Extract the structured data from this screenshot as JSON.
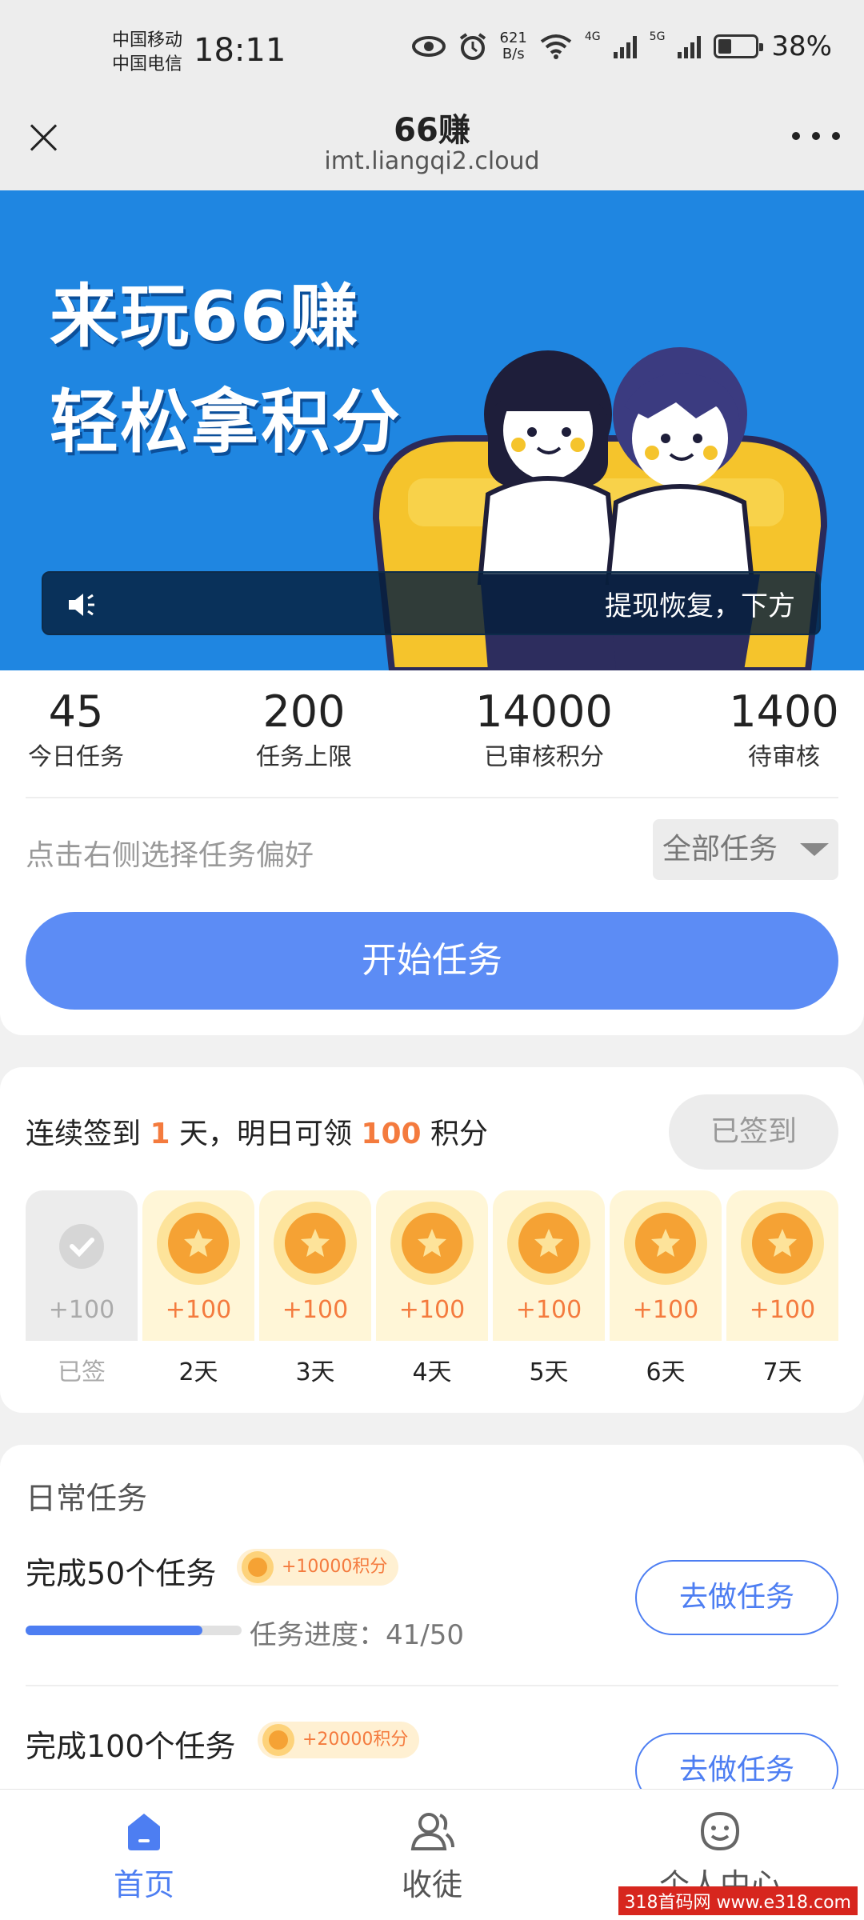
{
  "status_bar": {
    "carrier_1": "中国移动",
    "carrier_2": "中国电信",
    "time": "18:11",
    "net_speed_value": "621",
    "net_speed_unit": "B/s",
    "net_1": "4G",
    "net_2": "5G",
    "battery": "38%"
  },
  "nav": {
    "title": "66赚",
    "url": "imt.liangqi2.cloud"
  },
  "banner": {
    "line_1": "来玩66赚",
    "line_2": "轻松拿积分",
    "notice": "提现恢复，下方"
  },
  "stats": [
    {
      "value": "45",
      "label": "今日任务"
    },
    {
      "value": "200",
      "label": "任务上限"
    },
    {
      "value": "14000",
      "label": "已审核积分"
    },
    {
      "value": "1400",
      "label": "待审核"
    }
  ],
  "preference": {
    "hint": "点击右侧选择任务偏好",
    "selected": "全部任务"
  },
  "start_button": "开始任务",
  "signin": {
    "prefix": "连续签到 ",
    "days": "1",
    "middle": " 天，明日可领 ",
    "points": "100",
    "suffix": " 积分",
    "button": "已签到",
    "items": [
      {
        "points": "+100",
        "label": "已签",
        "done": true
      },
      {
        "points": "+100",
        "label": "2天",
        "done": false
      },
      {
        "points": "+100",
        "label": "3天",
        "done": false
      },
      {
        "points": "+100",
        "label": "4天",
        "done": false
      },
      {
        "points": "+100",
        "label": "5天",
        "done": false
      },
      {
        "points": "+100",
        "label": "6天",
        "done": false
      },
      {
        "points": "+100",
        "label": "7天",
        "done": false
      }
    ]
  },
  "daily_tasks": {
    "title": "日常任务",
    "items": [
      {
        "name": "完成50个任务",
        "reward": "+10000积分",
        "progress_label": "任务进度：41/50",
        "progress": 0.82,
        "button": "去做任务"
      },
      {
        "name": "完成100个任务",
        "reward": "+20000积分",
        "button": "去做任务"
      }
    ]
  },
  "tabbar": {
    "items": [
      {
        "label": "首页",
        "icon": "home-icon",
        "active": true
      },
      {
        "label": "收徒",
        "icon": "users-icon",
        "active": false
      },
      {
        "label": "个人中心",
        "icon": "smile-face-icon",
        "active": false
      }
    ]
  },
  "watermark": "318首码网 www.e318.com",
  "colors": {
    "accent": "#5c8cf5",
    "banner": "#1f86e1",
    "orange": "#f47b3e"
  }
}
